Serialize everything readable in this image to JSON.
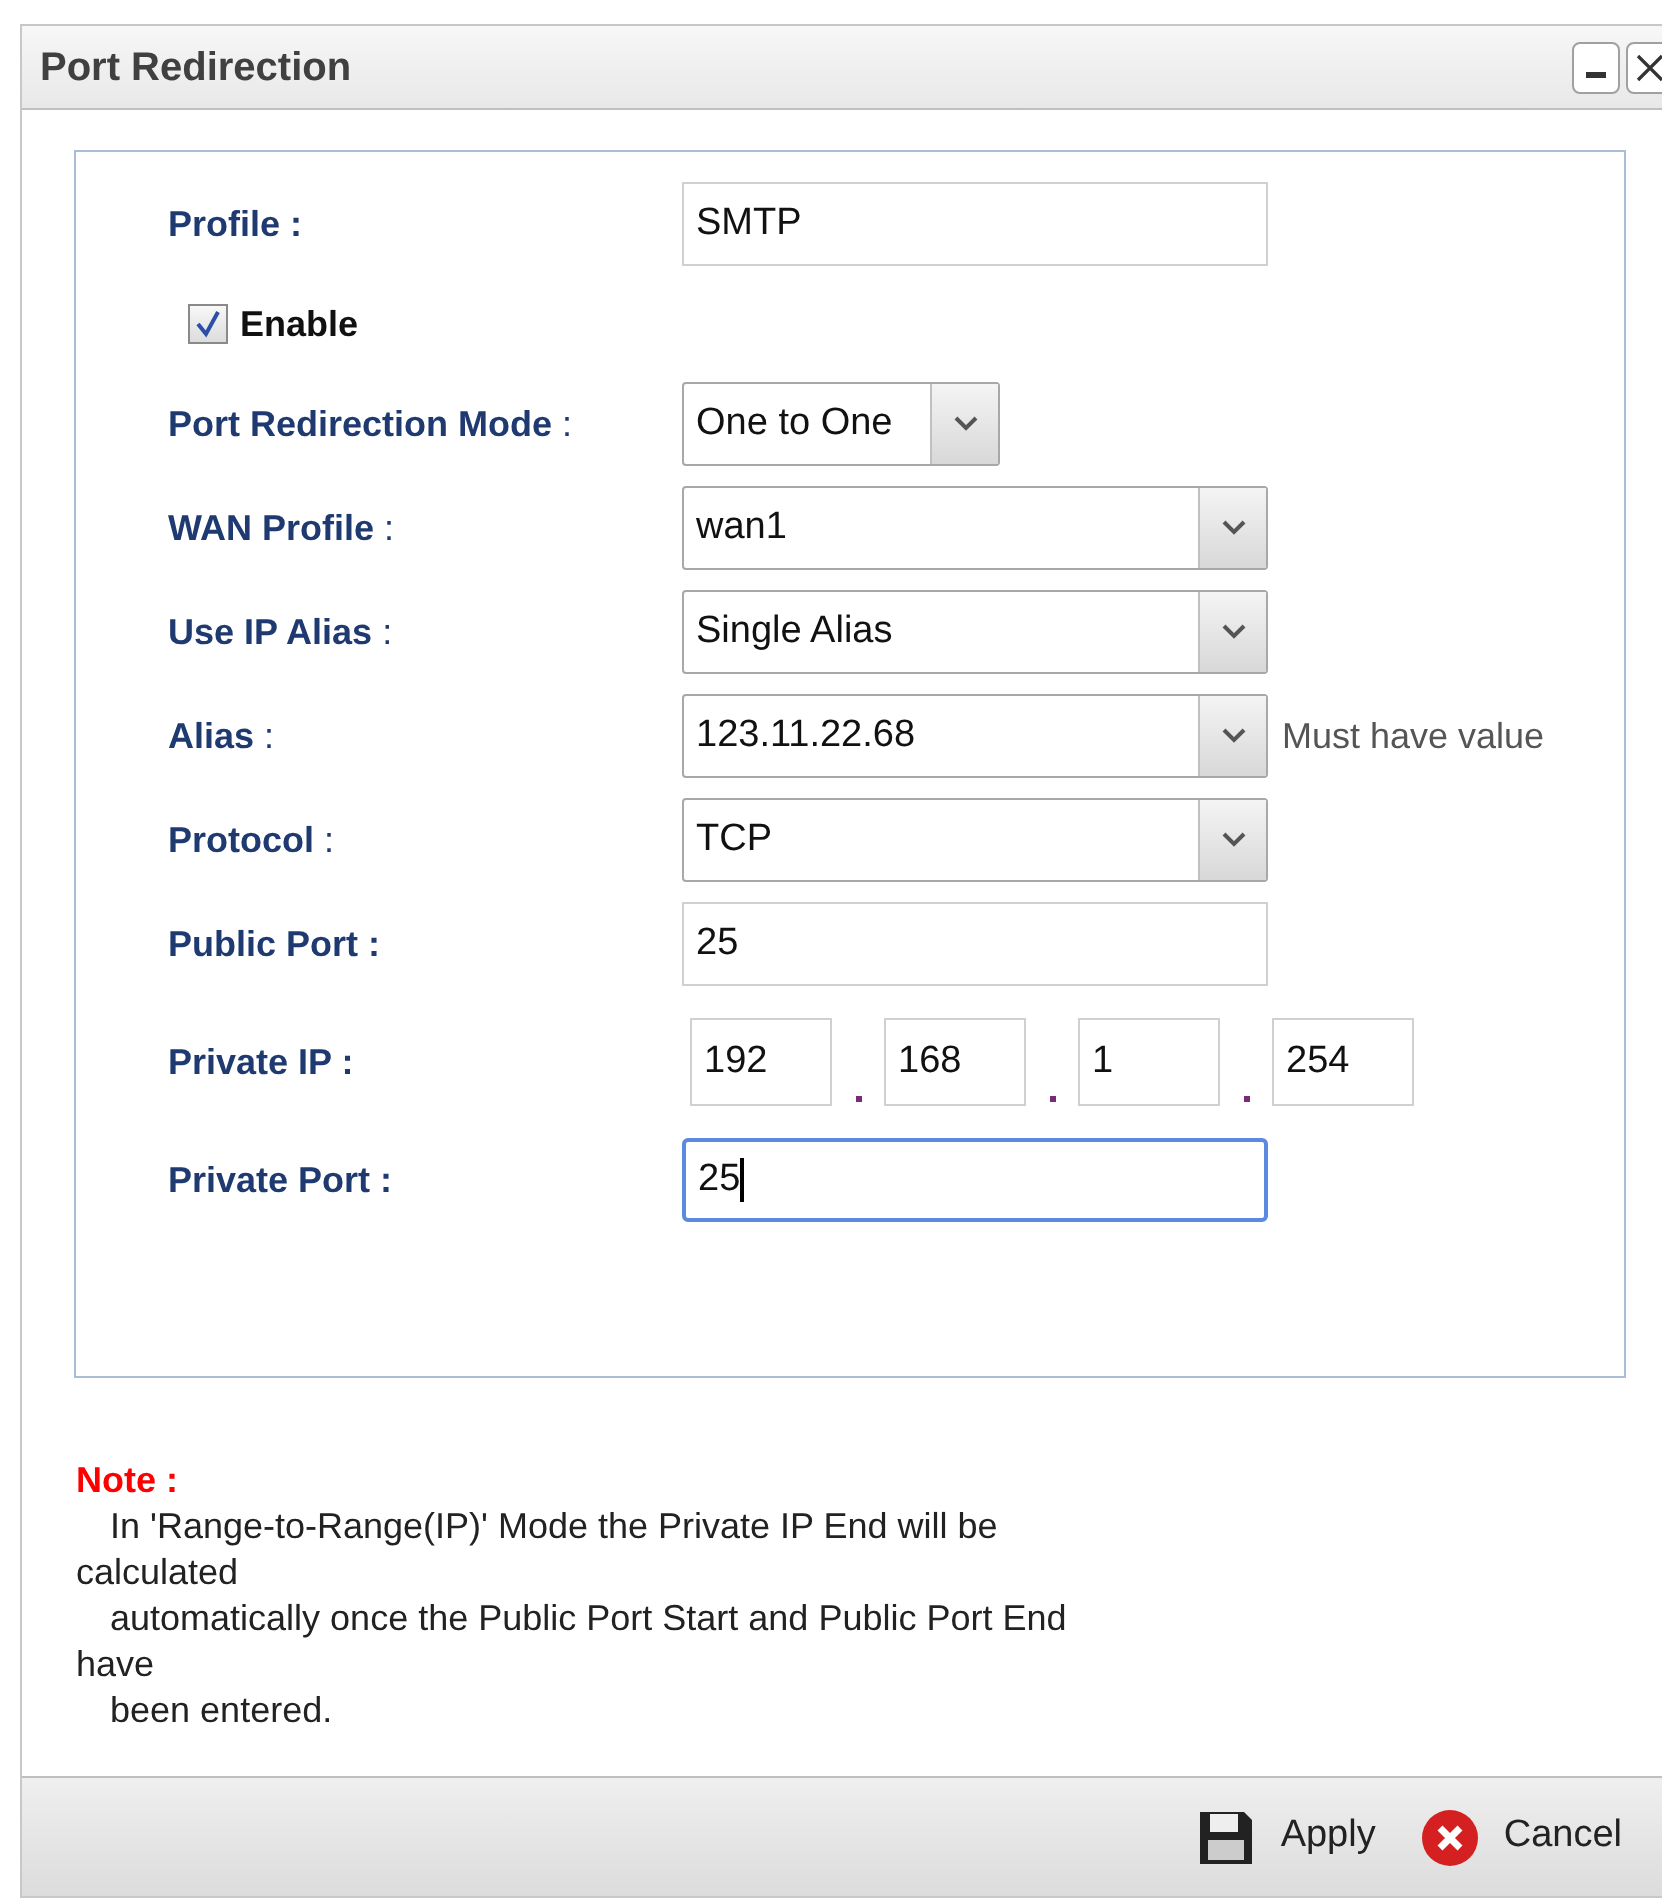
{
  "window": {
    "title": "Port Redirection"
  },
  "form": [
    {
      "kind": "text",
      "label": "**Profile :**",
      "value": "SMTP",
      "focused": false
    },
    {
      "kind": "checkbox",
      "label": "Enable",
      "checked": true
    },
    {
      "kind": "select",
      "label": "**Port Redirection Mode** :",
      "value": "One to One",
      "narrow": true
    },
    {
      "kind": "select",
      "label": "**WAN Profile** :",
      "value": "wan1",
      "narrow": false
    },
    {
      "kind": "select",
      "label": "**Use IP Alias** :",
      "value": "Single Alias",
      "narrow": false
    },
    {
      "kind": "select",
      "label": "**Alias** :",
      "value": "123.11.22.68",
      "narrow": false,
      "hint": "Must have value"
    },
    {
      "kind": "select",
      "label": "**Protocol** :",
      "value": "TCP",
      "narrow": false
    },
    {
      "kind": "text",
      "label": "**Public Port :**",
      "value": "25",
      "focused": false
    },
    {
      "kind": "ip",
      "label": "**Private IP :**",
      "octets": [
        "192",
        "168",
        "1",
        "254"
      ]
    },
    {
      "kind": "text",
      "label": "**Private Port :**",
      "value": "25",
      "focused": true
    }
  ],
  "note": {
    "title": "Note :",
    "lines": [
      {
        "text": "In 'Range-to-Range(IP)' Mode the Private IP End will be",
        "indented": true
      },
      {
        "text": "calculated",
        "indented": false
      },
      {
        "text": "automatically once the Public Port Start and Public Port End",
        "indented": true
      },
      {
        "text": "have",
        "indented": false
      },
      {
        "text": "been entered.",
        "indented": true
      }
    ]
  },
  "buttons": [
    {
      "kind": "apply",
      "label": "Apply"
    },
    {
      "kind": "cancel",
      "label": "Cancel"
    }
  ]
}
